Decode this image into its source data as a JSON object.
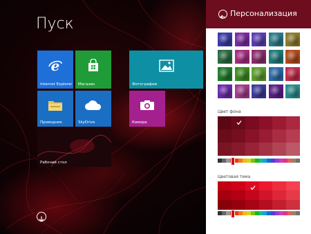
{
  "start": {
    "title": "Пуск",
    "tiles": [
      {
        "id": "ie",
        "label": "Internet Explorer",
        "color": "#1e6fd8"
      },
      {
        "id": "store",
        "label": "Магазин",
        "color": "#1f9c38"
      },
      {
        "id": "photos",
        "label": "Фотографии",
        "color": "#0f8fa3"
      },
      {
        "id": "explorer",
        "label": "Проводник",
        "color": "#1a6fc4"
      },
      {
        "id": "skydrive",
        "label": "SkyDrive",
        "color": "#1a6fc4"
      },
      {
        "id": "camera",
        "label": "Камера",
        "color": "#a4208f"
      },
      {
        "id": "desktop",
        "label": "Рабочий стол",
        "color": "#2a1015"
      }
    ]
  },
  "pane": {
    "title": "Персонализация",
    "background_color_label": "Цвет фона",
    "accent_color_label": "Цветовая тема",
    "header_color": "#6e0d1e",
    "pattern_colors": [
      [
        "#3a3aa8",
        "#7a2aa0",
        "#5a3cb0",
        "#2a7a88",
        "#8a7a2a"
      ],
      [
        "#2a6a40",
        "#a42a80",
        "#8a2a6a",
        "#1e7a7a",
        "#b04a1a"
      ],
      [
        "#1e7a2a",
        "#3a8a1e",
        "#5a9a2a",
        "#2a6aa8",
        "#c02a4a"
      ],
      [
        "#6a2aa8",
        "#a03a8a",
        "#3a3a9a",
        "#5a1e88",
        "#2a8a8a"
      ]
    ],
    "background_swatches": [
      [
        "#5c0814",
        "#68091a",
        "#7a0b20",
        "#8c1028",
        "#9c1a32",
        "#aa2840"
      ],
      [
        "#6a0c1a",
        "#760e20",
        "#881228",
        "#9a1c34",
        "#a82c42",
        "#b63c52"
      ],
      [
        "#7a1424",
        "#861a2c",
        "#962436",
        "#a43244",
        "#b04454",
        "#bc5868"
      ]
    ],
    "accent_swatches": [
      [
        "#c20014",
        "#d0001a",
        "#de0a22",
        "#ec1a30",
        "#f02c40",
        "#f44050"
      ],
      [
        "#a6000e",
        "#b40014",
        "#c4061c",
        "#d21428",
        "#de2636",
        "#e63a48"
      ],
      [
        "#880008",
        "#96000e",
        "#a60414",
        "#b40e20",
        "#c21e2e",
        "#ce303e"
      ]
    ],
    "slider_colors": [
      "#333333",
      "#666666",
      "#999999",
      "#cc2222",
      "#e63a1a",
      "#f07a1a",
      "#f0b81a",
      "#d6d61a",
      "#7ac21a",
      "#1ab81a",
      "#1ab8a0",
      "#1aa0d6",
      "#1a6ad6",
      "#5a3ad6",
      "#9a3ad6",
      "#d63ab8",
      "#d63a7a",
      "#e06060",
      "#a08060",
      "#707070"
    ]
  }
}
